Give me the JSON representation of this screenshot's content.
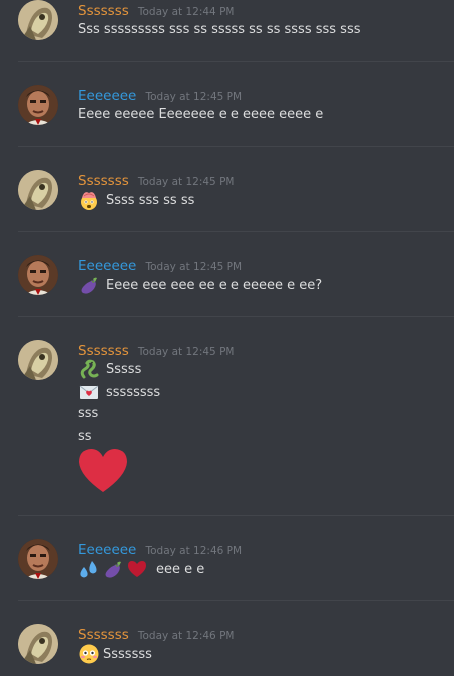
{
  "colors": {
    "background": "#36393f",
    "user_s_color": "#e3943c",
    "user_e_color": "#3498db",
    "text": "#dcddde",
    "timestamp": "#72767d",
    "heart": "#dd2e44"
  },
  "messages": [
    {
      "username": "Sssssss",
      "timestamp": "Today at 12:44 PM",
      "lines": [
        "Sss sssssssss sss ss sssss ss ss ssss sss sss"
      ]
    },
    {
      "username": "Eeeeeee",
      "timestamp": "Today at 12:45 PM",
      "lines": [
        "Eeee eeeee Eeeeeee e e eeee eeee e"
      ]
    },
    {
      "username": "Sssssss",
      "timestamp": "Today at 12:45 PM",
      "lines": [
        "Ssss sss ss ss"
      ],
      "icons": [
        "face-with-exploding-head-icon"
      ]
    },
    {
      "username": "Eeeeeee",
      "timestamp": "Today at 12:45 PM",
      "lines": [
        "Eeee eee eee  ee e e eeeee e ee?"
      ],
      "icons": [
        "eggplant-icon"
      ]
    },
    {
      "username": "Sssssss",
      "timestamp": "Today at 12:45 PM",
      "lines": [
        "Sssss",
        "ssssssss",
        "sss",
        "ss"
      ],
      "icons": [
        "snake-icon",
        "love-letter-icon",
        "big-red-heart-icon"
      ]
    },
    {
      "username": "Eeeeeee",
      "timestamp": "Today at 12:46 PM",
      "lines": [
        "eee e e"
      ],
      "icons": [
        "sweat-droplets-icon",
        "eggplant-icon",
        "red-heart-icon"
      ]
    },
    {
      "username": "Sssssss",
      "timestamp": "Today at 12:46 PM",
      "lines": [
        "Sssssss"
      ],
      "icons": [
        "flushed-face-icon"
      ]
    }
  ]
}
